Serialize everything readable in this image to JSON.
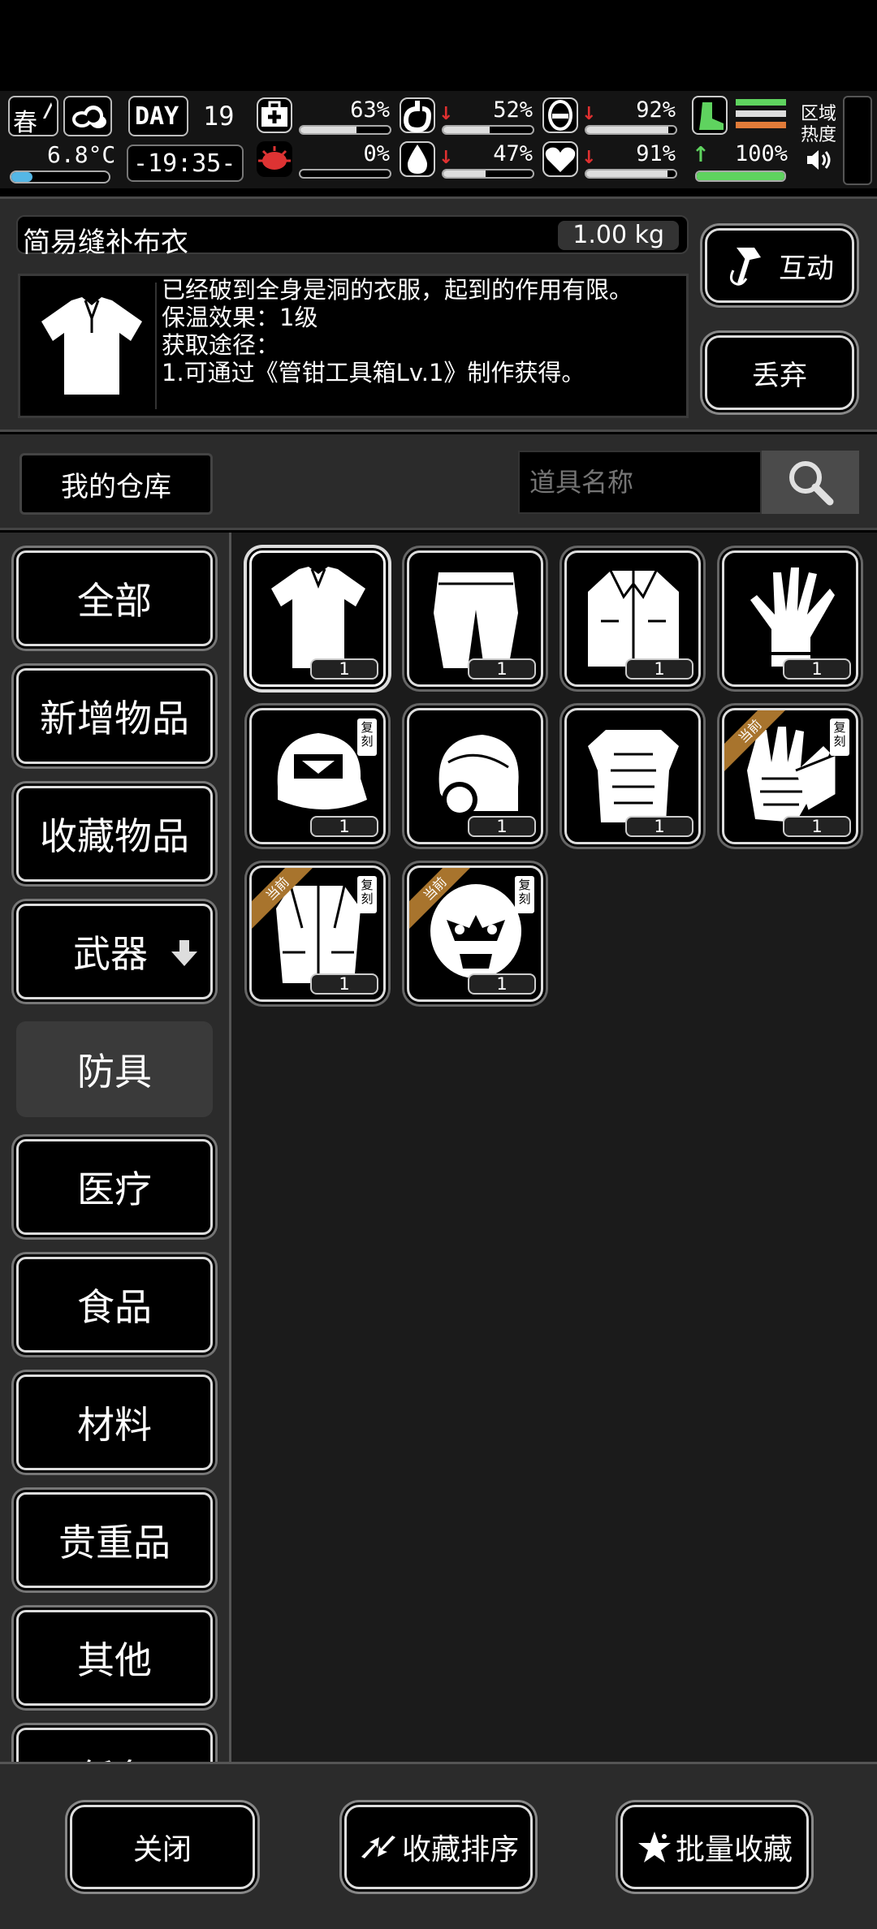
{
  "status": {
    "season": "春",
    "day_label": "DAY",
    "day": "19",
    "temperature": "6.8°C",
    "time": "-19:35-",
    "zone_heat": [
      "区域",
      "热度"
    ],
    "stats": [
      {
        "name": "health",
        "icon": "first-aid-icon",
        "arrow": "",
        "value": "63%",
        "level": 0.63,
        "color": "#dddddd"
      },
      {
        "name": "hunger",
        "icon": "stomach-icon",
        "arrow": "↓",
        "value": "52%",
        "level": 0.52,
        "color": "#dddddd"
      },
      {
        "name": "stamina",
        "icon": "capsule-icon",
        "arrow": "↓",
        "value": "92%",
        "level": 0.92,
        "color": "#dddddd"
      },
      {
        "name": "infection",
        "icon": "virus-icon",
        "arrow": "",
        "value": "0%",
        "level": 0.0,
        "color": "#dddddd"
      },
      {
        "name": "thirst",
        "icon": "water-drop-icon",
        "arrow": "↓",
        "value": "47%",
        "level": 0.47,
        "color": "#dddddd"
      },
      {
        "name": "mood",
        "icon": "heart-icon",
        "arrow": "↓",
        "value": "91%",
        "level": 0.91,
        "color": "#dddddd"
      }
    ],
    "extra_stat": {
      "arrow": "↑",
      "value": "100%",
      "level": 1.0,
      "color": "#5fd35f"
    }
  },
  "item": {
    "name": "简易缝补布衣",
    "weight": "1.00 kg",
    "description": [
      "已经破到全身是洞的衣服，起到的作用有限。",
      "保温效果：1级",
      "获取途径：",
      "1.可通过《管钳工具箱Lv.1》制作获得。"
    ],
    "interact_label": "互动",
    "discard_label": "丢弃"
  },
  "storage": {
    "tab_label": "我的仓库",
    "search_placeholder": "道具名称"
  },
  "categories": [
    {
      "label": "全部",
      "active": false
    },
    {
      "label": "新增物品",
      "active": false
    },
    {
      "label": "收藏物品",
      "active": false
    },
    {
      "label": "武器",
      "active": false,
      "expand": true
    },
    {
      "label": "防具",
      "active": true
    },
    {
      "label": "医疗",
      "active": false
    },
    {
      "label": "食品",
      "active": false
    },
    {
      "label": "材料",
      "active": false
    },
    {
      "label": "贵重品",
      "active": false
    },
    {
      "label": "其他",
      "active": false
    },
    {
      "label": "任务",
      "active": false
    }
  ],
  "items": [
    {
      "icon": "shirt-icon",
      "count": "1",
      "selected": true,
      "tag": "",
      "ribbon": ""
    },
    {
      "icon": "pants-icon",
      "count": "1",
      "selected": false,
      "tag": "",
      "ribbon": ""
    },
    {
      "icon": "jacket-icon",
      "count": "1",
      "selected": false,
      "tag": "",
      "ribbon": ""
    },
    {
      "icon": "glove-icon",
      "count": "1",
      "selected": false,
      "tag": "",
      "ribbon": ""
    },
    {
      "icon": "cap-icon",
      "count": "1",
      "selected": false,
      "tag": "复刻",
      "ribbon": ""
    },
    {
      "icon": "helmet-icon",
      "count": "1",
      "selected": false,
      "tag": "",
      "ribbon": ""
    },
    {
      "icon": "body-armor-icon",
      "count": "1",
      "selected": false,
      "tag": "",
      "ribbon": ""
    },
    {
      "icon": "armored-gloves-icon",
      "count": "1",
      "selected": false,
      "tag": "复刻",
      "ribbon": "当前"
    },
    {
      "icon": "armored-coat-icon",
      "count": "1",
      "selected": false,
      "tag": "复刻",
      "ribbon": "当前"
    },
    {
      "icon": "armored-mask-icon",
      "count": "1",
      "selected": false,
      "tag": "复刻",
      "ribbon": "当前"
    }
  ],
  "bottom": {
    "close_label": "关闭",
    "sort_label": "收藏排序",
    "batch_label": "批量收藏"
  }
}
